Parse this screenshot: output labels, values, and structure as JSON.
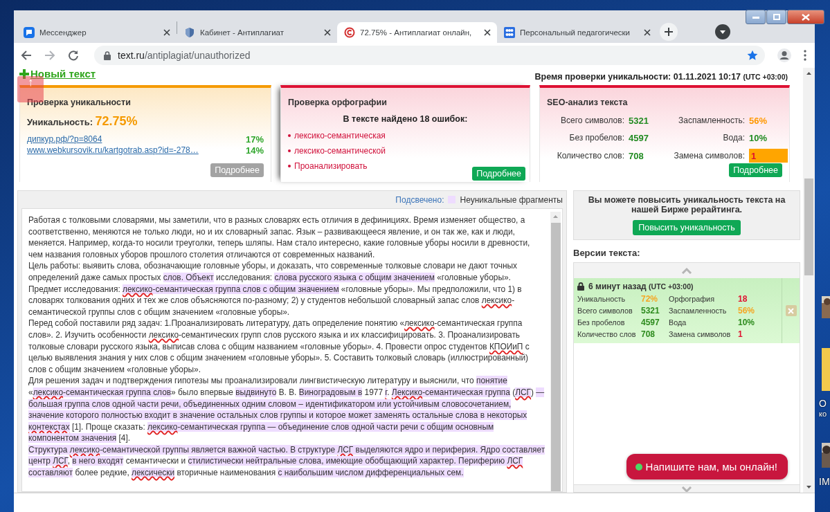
{
  "tabs": [
    {
      "title": "Мессенджер",
      "selected": false
    },
    {
      "title": "Кабинет - Антиплагиат",
      "selected": false
    },
    {
      "title": "72.75% - Антиплагиат онлайн,",
      "selected": true
    },
    {
      "title": "Персональный педагогически",
      "selected": false
    }
  ],
  "address_bar": {
    "host": "text.ru",
    "path": "/antiplagiat/unauthorized"
  },
  "new_text_link": "Новый текст",
  "check_time": {
    "label": "Время проверки уникальности: 01.11.2021 10:17",
    "timezone": "(UTC +03:00)"
  },
  "scroll_top_button": "↑",
  "uniqueness_card": {
    "title": "Проверка уникальности",
    "label": "Уникальность:",
    "value": "72.75%",
    "sources": [
      {
        "url": "дипкур.рф/?p=8064",
        "percent": "17%"
      },
      {
        "url": "www.webkursovik.ru/kartgotrab.asp?id=-278…",
        "percent": "14%"
      }
    ],
    "button": "Подробнее"
  },
  "spelling_card": {
    "title": "Проверка орфографии",
    "summary": "В тексте найдено 18 ошибок:",
    "errors": [
      "лексико-семантическая",
      "лексико-семантической",
      "Проанализировать"
    ],
    "button": "Подробнее"
  },
  "seo_card": {
    "title": "SEO-анализ текста",
    "metrics": [
      {
        "label": "Всего символов:",
        "value": "5321",
        "color": "#228b22",
        "kind": "plain"
      },
      {
        "label": "Заспамленность:",
        "value": "56%",
        "color": "#ff9900",
        "kind": "plain"
      },
      {
        "label": "Без пробелов:",
        "value": "4597",
        "color": "#228b22",
        "kind": "plain"
      },
      {
        "label": "Вода:",
        "value": "10%",
        "color": "#228b22",
        "kind": "plain"
      },
      {
        "label": "Количество слов:",
        "value": "708",
        "color": "#228b22",
        "kind": "plain"
      },
      {
        "label": "Замена символов:",
        "value": "1",
        "color": "#e0102f",
        "kind": "flagged"
      }
    ],
    "button": "Подробнее"
  },
  "legend": {
    "label": "Подсвечено:",
    "text": "Неуникальные фрагменты"
  },
  "text_paragraphs": [
    [
      {
        "text": "Работая с толковыми словарями, мы заметили, что в разных словарях есть отличия в дефинициях. Время изменяет общество, а соответственно, меняются не только люди, но и их словарный запас. Язык – развивающееся явление, и он так же, как и люди, меняется. Например, когда-то носили треуголки, теперь шляпы. Нам стало интересно, какие головные уборы носили в древности, чем названия головных уборов прошлого столетия отличаются от современных названий.",
        "highlighted": false,
        "misspelled": false
      }
    ],
    [
      {
        "text": "Цель работы: выявить слова, обозначающие головные уборы, и доказать, что современные толковые словари не дают точных определений даже самых простых ",
        "highlighted": false,
        "misspelled": false
      },
      {
        "text": "слов. Объект",
        "highlighted": true,
        "misspelled": false
      },
      {
        "text": " исследования: ",
        "highlighted": false,
        "misspelled": false
      },
      {
        "text": "слова русского языка с общим значением",
        "highlighted": true,
        "misspelled": false
      },
      {
        "text": " «головные уборы».",
        "highlighted": false,
        "misspelled": false
      }
    ],
    [
      {
        "text": "Предмет исследования: ",
        "highlighted": false,
        "misspelled": false
      },
      {
        "text": "лексико",
        "highlighted": true,
        "misspelled": true
      },
      {
        "text": "-семантическая группа слов с общим значением",
        "highlighted": true,
        "misspelled": false
      },
      {
        "text": " «головные уборы». Мы предположили, что 1) в словарях толкования одних и тех же слов объясняются по-разному; 2) у студентов небольшой словарный запас слов ",
        "highlighted": false,
        "misspelled": false
      },
      {
        "text": "лексико",
        "highlighted": false,
        "misspelled": true
      },
      {
        "text": "-семантической группы слов с общим значением «головные уборы».",
        "highlighted": false,
        "misspelled": false
      }
    ],
    [
      {
        "text": "Перед собой поставили ряд задач: 1.Проанализировать литературу, дать определение понятию «",
        "highlighted": false,
        "misspelled": false
      },
      {
        "text": "лексико",
        "highlighted": false,
        "misspelled": true
      },
      {
        "text": "-семантическая группа слов». 2. Изучить особенности ",
        "highlighted": false,
        "misspelled": false
      },
      {
        "text": "лексико",
        "highlighted": false,
        "misspelled": true
      },
      {
        "text": "-семантических групп слов русского языка и их классифицировать. 3. Проанализировать толковые словари русского языка, выписав слова с общим названием «головные уборы». 4. Провести опрос студентов ",
        "highlighted": false,
        "misspelled": false
      },
      {
        "text": "КПОИиП",
        "highlighted": false,
        "misspelled": true
      },
      {
        "text": " с целью выявления знания у них слов с общим значением «головные уборы». 5. Составить толковый словарь (иллюстрированный) слов с общим значением «головные уборы».",
        "highlighted": false,
        "misspelled": false
      }
    ],
    [
      {
        "text": "Для решения задач и подтверждения гипотезы мы проанализировали лингвистическую литературу и выяснили, что ",
        "highlighted": false,
        "misspelled": false
      },
      {
        "text": "понятие",
        "highlighted": true,
        "misspelled": false
      },
      {
        "text": " «",
        "highlighted": false,
        "misspelled": false
      },
      {
        "text": "лексико",
        "highlighted": true,
        "misspelled": true
      },
      {
        "text": "-семантическая группа слов",
        "highlighted": true,
        "misspelled": false
      },
      {
        "text": "» было впервые ",
        "highlighted": false,
        "misspelled": false
      },
      {
        "text": "выдвинуто",
        "highlighted": true,
        "misspelled": false
      },
      {
        "text": " В. В. ",
        "highlighted": false,
        "misspelled": false
      },
      {
        "text": "Виноградовым ",
        "highlighted": true,
        "misspelled": false
      },
      {
        "text": "в",
        "highlighted": true,
        "misspelled": false
      },
      {
        "text": " 1977 ",
        "highlighted": false,
        "misspelled": false
      },
      {
        "text": "г",
        "highlighted": true,
        "misspelled": true
      },
      {
        "text": ". ",
        "highlighted": false,
        "misspelled": false
      },
      {
        "text": "Лексико",
        "highlighted": true,
        "misspelled": true
      },
      {
        "text": "-семантическая группа",
        "highlighted": true,
        "misspelled": false
      },
      {
        "text": " (",
        "highlighted": false,
        "misspelled": false
      },
      {
        "text": "ЛСГ",
        "highlighted": true,
        "misspelled": true
      },
      {
        "text": ") ",
        "highlighted": false,
        "misspelled": false
      },
      {
        "text": "— большая группа слов одной части речи, объединенных одним словом – идентификатором или устойчивым словосочетанием, значение которого полностью входит в значение остальных слов группы и которое может заменять остальные слова в некоторых ",
        "highlighted": true,
        "misspelled": false
      },
      {
        "text": "контекстах",
        "highlighted": true,
        "misspelled": true
      },
      {
        "text": " [1]. Проще сказать: ",
        "highlighted": false,
        "misspelled": false
      },
      {
        "text": "лексико",
        "highlighted": true,
        "misspelled": true
      },
      {
        "text": "-семантическая группа — объединение слов одной части речи с общим основным компонентом значения",
        "highlighted": true,
        "misspelled": false
      },
      {
        "text": " [4].",
        "highlighted": false,
        "misspelled": false
      }
    ],
    [
      {
        "text": "Структура ",
        "highlighted": true,
        "misspelled": false
      },
      {
        "text": "лексико",
        "highlighted": true,
        "misspelled": true
      },
      {
        "text": "-семантической группы является важной частью. В структуре ",
        "highlighted": true,
        "misspelled": false
      },
      {
        "text": "ЛСГ",
        "highlighted": true,
        "misspelled": true
      },
      {
        "text": " выделяются ядро и периферия. Ядро составляет центр ",
        "highlighted": true,
        "misspelled": false
      },
      {
        "text": "ЛСГ",
        "highlighted": true,
        "misspelled": true
      },
      {
        "text": ", ",
        "highlighted": false,
        "misspelled": false
      },
      {
        "text": "в него входят",
        "highlighted": true,
        "misspelled": false
      },
      {
        "text": " семантически и ",
        "highlighted": false,
        "misspelled": false
      },
      {
        "text": "стилистически нейтральные слова, имеющие обобщающий характер. Периферию ",
        "highlighted": true,
        "misspelled": false
      },
      {
        "text": "ЛСГ",
        "highlighted": true,
        "misspelled": true
      },
      {
        "text": " составляют",
        "highlighted": true,
        "misspelled": false
      },
      {
        "text": " более редкие, ",
        "highlighted": false,
        "misspelled": false
      },
      {
        "text": "лексически",
        "highlighted": true,
        "misspelled": true
      },
      {
        "text": " вторичные наименования ",
        "highlighted": false,
        "misspelled": false
      },
      {
        "text": "с наибольшим числом дифференциальных сем.",
        "highlighted": true,
        "misspelled": false
      }
    ]
  ],
  "promo": {
    "text": "Вы можете повысить уникальность текста на нашей Бирже рерайтинга.",
    "button": "Повысить уникальность"
  },
  "versions": {
    "title": "Версии текста:",
    "items": [
      {
        "time": "6 минут назад",
        "timezone": "(UTC +03:00)",
        "locked": true,
        "stats": [
          {
            "label": "Уникальность",
            "value": "72%",
            "color": "#f5a623"
          },
          {
            "label": "Орфография",
            "value": "18",
            "color": "#e0102f"
          },
          {
            "label": "Всего символов",
            "value": "5321",
            "color": "#2e8b1e"
          },
          {
            "label": "Заспамленность",
            "value": "56%",
            "color": "#f5a623"
          },
          {
            "label": "Без пробелов",
            "value": "4597",
            "color": "#2e8b1e"
          },
          {
            "label": "Вода",
            "value": "10%",
            "color": "#2e8b1e"
          },
          {
            "label": "Количество слов",
            "value": "708",
            "color": "#2e8b1e"
          },
          {
            "label": "Замена символов",
            "value": "1",
            "color": "#e0102f"
          }
        ]
      }
    ]
  },
  "chat_button": {
    "label": "Напишите нам, мы онлайн!",
    "online": true
  },
  "desktop_icons": [
    {
      "lines": [
        "О",
        "ко"
      ]
    },
    {
      "lines": [
        "IM"
      ]
    }
  ]
}
